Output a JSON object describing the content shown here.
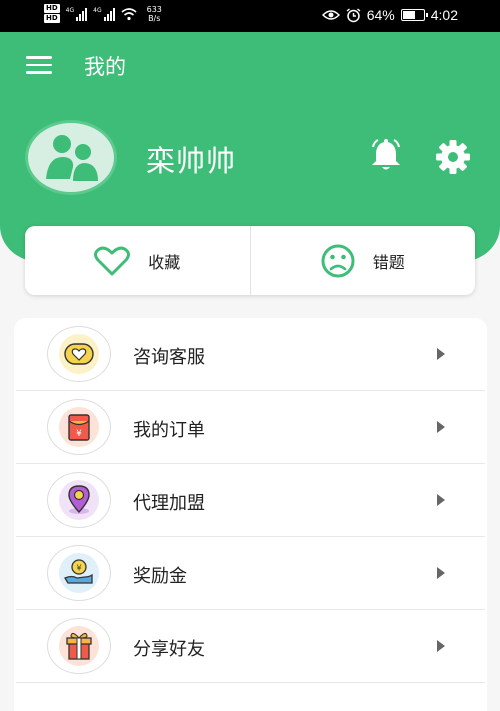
{
  "status_bar": {
    "network": "HD",
    "signal1": "4G",
    "signal2": "4G",
    "speed_value": "633",
    "speed_unit": "B/s",
    "battery": "64%",
    "battery_level": 0.64,
    "time": "4:02"
  },
  "header": {
    "title": "我的",
    "username": "栾帅帅"
  },
  "quick_actions": [
    {
      "label": "收藏",
      "icon": "heart-icon"
    },
    {
      "label": "错题",
      "icon": "sad-face-icon"
    }
  ],
  "menu": [
    {
      "label": "咨询客服",
      "icon": "heart-chat-icon"
    },
    {
      "label": "我的订单",
      "icon": "red-envelope-icon"
    },
    {
      "label": "代理加盟",
      "icon": "location-pin-icon"
    },
    {
      "label": "奖励金",
      "icon": "money-hand-icon"
    },
    {
      "label": "分享好友",
      "icon": "gift-icon"
    }
  ],
  "colors": {
    "accent": "#3dbd77"
  }
}
